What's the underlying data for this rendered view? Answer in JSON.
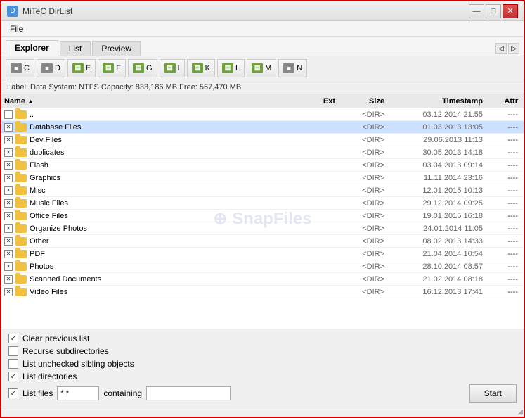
{
  "window": {
    "title": "MiTeC DirList",
    "icon": "D"
  },
  "titleButtons": {
    "minimize": "—",
    "maximize": "□",
    "close": "✕"
  },
  "menu": {
    "items": [
      "File"
    ]
  },
  "tabs": {
    "items": [
      "Explorer",
      "List",
      "Preview"
    ],
    "active": 0
  },
  "toolbar": {
    "buttons": [
      {
        "label": "C",
        "icon": "drive"
      },
      {
        "label": "D",
        "icon": "drive"
      },
      {
        "label": "E",
        "icon": "folder"
      },
      {
        "label": "F",
        "icon": "folder"
      },
      {
        "label": "G",
        "icon": "folder"
      },
      {
        "label": "I",
        "icon": "folder"
      },
      {
        "label": "K",
        "icon": "folder"
      },
      {
        "label": "L",
        "icon": "folder"
      },
      {
        "label": "M",
        "icon": "folder"
      },
      {
        "label": "N",
        "icon": "drive"
      }
    ]
  },
  "infoBar": {
    "text": "Label: Data   System: NTFS   Capacity: 833,186 MB   Free: 567,470 MB"
  },
  "fileList": {
    "columns": {
      "name": "Name",
      "ext": "Ext",
      "size": "Size",
      "timestamp": "Timestamp",
      "attr": "Attr"
    },
    "rows": [
      {
        "checked": false,
        "name": "",
        "isParent": true,
        "ext": "",
        "size": "<DIR>",
        "timestamp": "03.12.2014 21:55",
        "attr": "----"
      },
      {
        "checked": true,
        "name": "Database Files",
        "isParent": false,
        "ext": "",
        "size": "<DIR>",
        "timestamp": "01.03.2013 13:05",
        "attr": "----",
        "selected": true
      },
      {
        "checked": true,
        "name": "Dev Files",
        "isParent": false,
        "ext": "",
        "size": "<DIR>",
        "timestamp": "29.06.2013 11:13",
        "attr": "----"
      },
      {
        "checked": true,
        "name": "duplicates",
        "isParent": false,
        "ext": "",
        "size": "<DIR>",
        "timestamp": "30.05.2013 14:18",
        "attr": "----"
      },
      {
        "checked": true,
        "name": "Flash",
        "isParent": false,
        "ext": "",
        "size": "<DIR>",
        "timestamp": "03.04.2013 09:14",
        "attr": "----"
      },
      {
        "checked": true,
        "name": "Graphics",
        "isParent": false,
        "ext": "",
        "size": "<DIR>",
        "timestamp": "11.11.2014 23:16",
        "attr": "----"
      },
      {
        "checked": true,
        "name": "Misc",
        "isParent": false,
        "ext": "",
        "size": "<DIR>",
        "timestamp": "12.01.2015 10:13",
        "attr": "----"
      },
      {
        "checked": true,
        "name": "Music Files",
        "isParent": false,
        "ext": "",
        "size": "<DIR>",
        "timestamp": "29.12.2014 09:25",
        "attr": "----"
      },
      {
        "checked": true,
        "name": "Office Files",
        "isParent": false,
        "ext": "",
        "size": "<DIR>",
        "timestamp": "19.01.2015 16:18",
        "attr": "----"
      },
      {
        "checked": true,
        "name": "Organize Photos",
        "isParent": false,
        "ext": "",
        "size": "<DIR>",
        "timestamp": "24.01.2014 11:05",
        "attr": "----"
      },
      {
        "checked": true,
        "name": "Other",
        "isParent": false,
        "ext": "",
        "size": "<DIR>",
        "timestamp": "08.02.2013 14:33",
        "attr": "----"
      },
      {
        "checked": true,
        "name": "PDF",
        "isParent": false,
        "ext": "",
        "size": "<DIR>",
        "timestamp": "21.04.2014 10:54",
        "attr": "----"
      },
      {
        "checked": true,
        "name": "Photos",
        "isParent": false,
        "ext": "",
        "size": "<DIR>",
        "timestamp": "28.10.2014 08:57",
        "attr": "----"
      },
      {
        "checked": true,
        "name": "Scanned Documents",
        "isParent": false,
        "ext": "",
        "size": "<DIR>",
        "timestamp": "21.02.2014 08:18",
        "attr": "----"
      },
      {
        "checked": true,
        "name": "Video Files",
        "isParent": false,
        "ext": "",
        "size": "<DIR>",
        "timestamp": "16.12.2013 17:41",
        "attr": "----"
      }
    ]
  },
  "watermark": "⊕ SnapFiles",
  "bottomPanel": {
    "checkboxes": [
      {
        "id": "clear-prev",
        "label": "Clear previous list",
        "checked": true
      },
      {
        "id": "recurse",
        "label": "Recurse subdirectories",
        "checked": false
      },
      {
        "id": "list-unchecked",
        "label": "List unchecked sibling objects",
        "checked": false
      },
      {
        "id": "list-dirs",
        "label": "List directories",
        "checked": true
      }
    ],
    "listFilesLabel": "List files",
    "patternValue": "*.*",
    "containingLabel": "containing",
    "containingValue": "",
    "startButton": "Start"
  }
}
